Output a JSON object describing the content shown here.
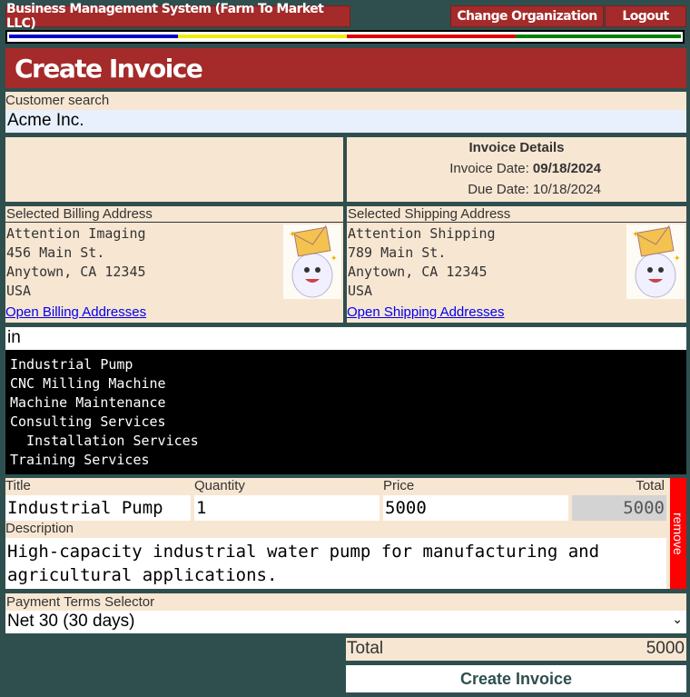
{
  "header": {
    "app_title": "Business Management System (Farm To Market LLC)",
    "change_org_label": "Change Organization",
    "logout_label": "Logout",
    "stripe_colors": [
      "#0000cc",
      "#eeee00",
      "#dd0000",
      "#008000"
    ]
  },
  "page_title": "Create Invoice",
  "customer": {
    "label": "Customer search",
    "value": "Acme Inc."
  },
  "invoice_details": {
    "heading": "Invoice Details",
    "invoice_date_label": "Invoice Date:",
    "invoice_date_value": "09/18/2024",
    "due_date_label": "Due Date:",
    "due_date_value": "10/18/2024"
  },
  "billing": {
    "label": "Selected Billing Address",
    "lines": [
      "Attention Imaging",
      "456 Main St.",
      "Anytown, CA 12345",
      "USA"
    ],
    "link": "Open Billing Addresses"
  },
  "shipping": {
    "label": "Selected Shipping Address",
    "lines": [
      "Attention Shipping",
      "789 Main St.",
      "Anytown, CA 12345",
      "USA"
    ],
    "link": "Open Shipping Addresses"
  },
  "product_search": {
    "value": "in",
    "results": [
      "Industrial Pump",
      "CNC Milling Machine",
      "Machine Maintenance",
      "Consulting Services",
      "  Installation Services",
      "Training Services"
    ]
  },
  "line_item": {
    "title_label": "Title",
    "quantity_label": "Quantity",
    "price_label": "Price",
    "total_label": "Total",
    "title_value": "Industrial Pump",
    "quantity_value": "1",
    "price_value": "5000",
    "total_value": "5000",
    "description_label": "Description",
    "description_value": "High-capacity industrial water pump for manufacturing and agricultural applications.",
    "remove_label": "remove"
  },
  "payment_terms": {
    "label": "Payment Terms Selector",
    "selected": "Net 30 (30 days)"
  },
  "summary": {
    "total_label": "Total",
    "total_value": "5000"
  },
  "create_button_label": "Create Invoice"
}
